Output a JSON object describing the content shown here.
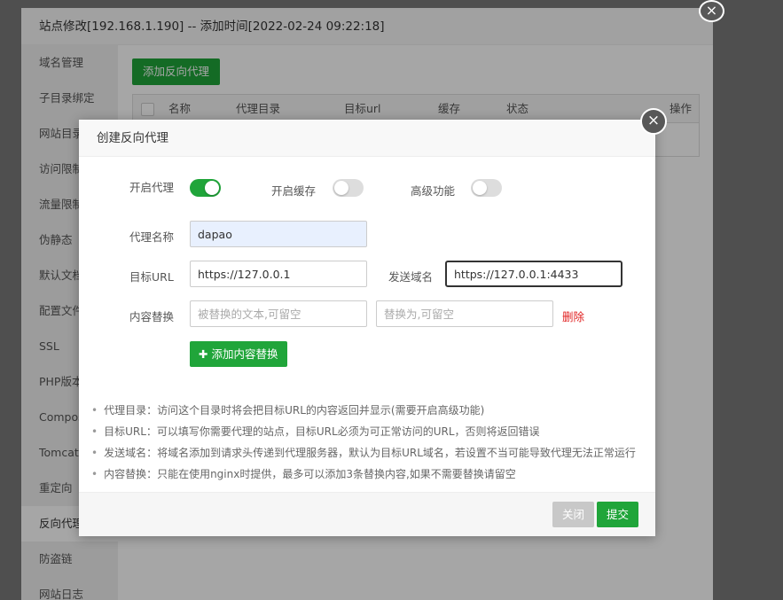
{
  "outer": {
    "title": "站点修改[192.168.1.190] -- 添加时间[2022-02-24 09:22:18]",
    "close_glyph": "×",
    "sidebar": [
      {
        "label": "域名管理"
      },
      {
        "label": "子目录绑定"
      },
      {
        "label": "网站目录"
      },
      {
        "label": "访问限制"
      },
      {
        "label": "流量限制"
      },
      {
        "label": "伪静态"
      },
      {
        "label": "默认文档"
      },
      {
        "label": "配置文件"
      },
      {
        "label": "SSL"
      },
      {
        "label": "PHP版本"
      },
      {
        "label": "Composer"
      },
      {
        "label": "Tomcat"
      },
      {
        "label": "重定向"
      },
      {
        "label": "反向代理"
      },
      {
        "label": "防盗链"
      },
      {
        "label": "网站日志"
      }
    ],
    "add_proxy_button": "添加反向代理",
    "table_headers": {
      "name": "名称",
      "dir": "代理目录",
      "url": "目标url",
      "cache": "缓存",
      "status": "状态",
      "ops": "操作"
    }
  },
  "dialog": {
    "title": "创建反向代理",
    "close_glyph": "×",
    "toggles": {
      "enable_proxy": {
        "label": "开启代理",
        "on": true
      },
      "enable_cache": {
        "label": "开启缓存",
        "on": false
      },
      "advanced": {
        "label": "高级功能",
        "on": false
      }
    },
    "proxy_name": {
      "label": "代理名称",
      "value": "dapao"
    },
    "target_url": {
      "label": "目标URL",
      "value": "https://127.0.0.1"
    },
    "send_domain": {
      "label": "发送域名",
      "value": "https://127.0.0.1:4433"
    },
    "content_replace": {
      "label": "内容替换",
      "from_placeholder": "被替换的文本,可留空",
      "to_placeholder": "替换为,可留空",
      "delete_label": "删除"
    },
    "add_replace_button": "添加内容替换",
    "notes": [
      "代理目录：访问这个目录时将会把目标URL的内容返回并显示(需要开启高级功能)",
      "目标URL：可以填写你需要代理的站点，目标URL必须为可正常访问的URL，否则将返回错误",
      "发送域名：将域名添加到请求头传递到代理服务器，默认为目标URL域名，若设置不当可能导致代理无法正常运行",
      "内容替换：只能在使用nginx时提供，最多可以添加3条替换内容,如果不需要替换请留空"
    ],
    "close_button": "关闭",
    "submit_button": "提交"
  },
  "colors": {
    "accent_green": "#20a53a",
    "danger_red": "#e02020",
    "disabled_gray": "#c8c8c8"
  }
}
